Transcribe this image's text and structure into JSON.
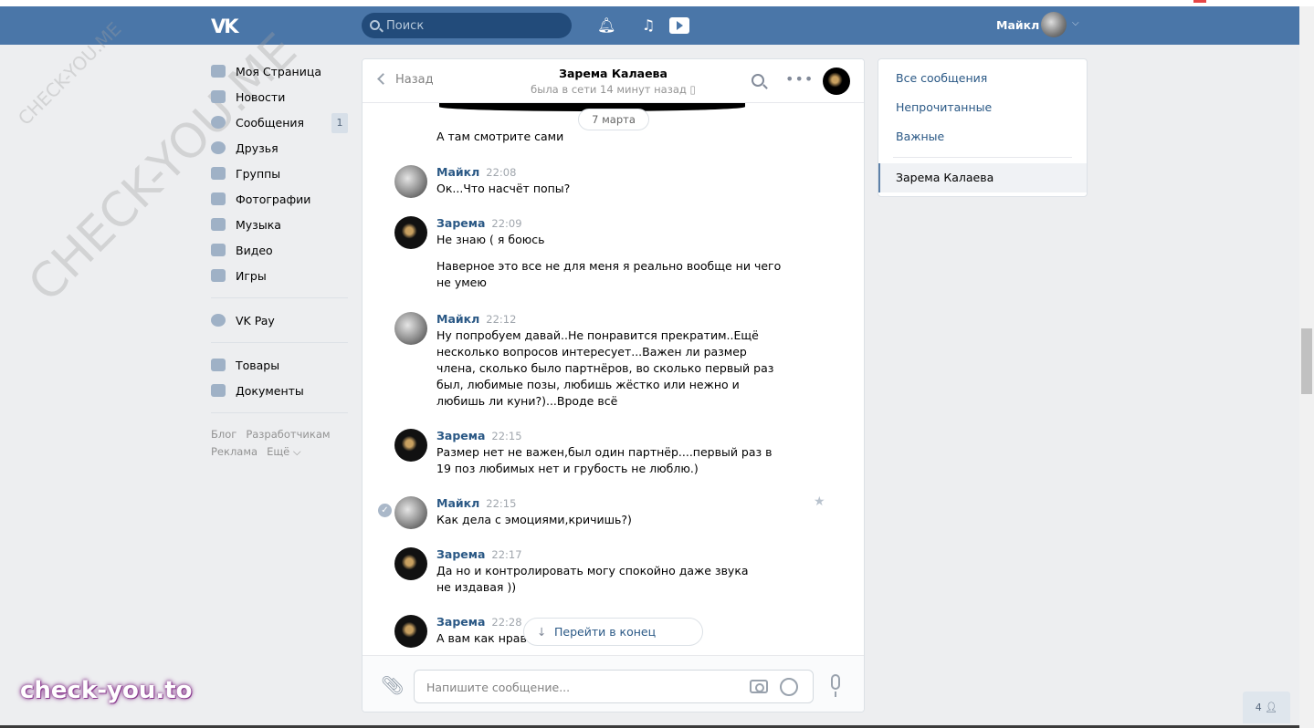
{
  "header": {
    "logo": "VK",
    "search_placeholder": "Поиск",
    "username": "Майкл"
  },
  "left_nav": {
    "items": [
      {
        "label": "Моя Страница",
        "icon": "home-icon"
      },
      {
        "label": "Новости",
        "icon": "news-icon"
      },
      {
        "label": "Сообщения",
        "icon": "messages-icon",
        "count": "1"
      },
      {
        "label": "Друзья",
        "icon": "friends-icon"
      },
      {
        "label": "Группы",
        "icon": "groups-icon"
      },
      {
        "label": "Фотографии",
        "icon": "camera-icon"
      },
      {
        "label": "Музыка",
        "icon": "music-icon"
      },
      {
        "label": "Видео",
        "icon": "video-icon"
      },
      {
        "label": "Игры",
        "icon": "games-icon"
      }
    ],
    "pay": {
      "label": "VK Pay",
      "icon": "vkpay-icon"
    },
    "extra": [
      {
        "label": "Товары",
        "icon": "bag-icon"
      },
      {
        "label": "Документы",
        "icon": "document-icon"
      }
    ],
    "footer": {
      "blog": "Блог",
      "devs": "Разработчикам",
      "ads": "Реклама",
      "more": "Ещё ⌵"
    }
  },
  "chat": {
    "back_label": "Назад",
    "peer_name": "Зарема Калаева",
    "peer_status": "была в сети 14 минут назад",
    "date_label": "7 марта",
    "jump_label": "Перейти в конец истории",
    "composer_placeholder": "Напишите сообщение...",
    "messages": [
      {
        "author": "",
        "time": "",
        "text": "А там смотрите сами"
      },
      {
        "author": "Майкл",
        "time": "22:08",
        "text": "Ок...Что насчёт попы?"
      },
      {
        "author": "Зарема",
        "time": "22:09",
        "text": "Не знаю ( я боюсь"
      },
      {
        "author": "",
        "time": "",
        "text": "Наверное это все не для меня я реально вообще ни чего не умею"
      },
      {
        "author": "Майкл",
        "time": "22:12",
        "text": "Ну попробуем давай..Не понравится прекратим..Ещё несколько вопросов интересует...Важен ли размер члена, сколько было партнёров, во сколько первый раз был, любимые позы, любишь жёстко или нежно и любишь ли куни?)...Вроде всё"
      },
      {
        "author": "Зарема",
        "time": "22:15",
        "text": "Размер нет не важен,был один партнёр....первый раз в 19 поз любимых нет и грубость не люблю.)"
      },
      {
        "author": "Майкл",
        "time": "22:15",
        "text": "Как дела с эмоциями,кричишь?)"
      },
      {
        "author": "Зарема",
        "time": "22:17",
        "text": "Да но и контролировать могу спокойно даже звука не издавая ))"
      },
      {
        "author": "Зарема",
        "time": "22:28",
        "text": "А вам как нрави"
      }
    ]
  },
  "right_menu": {
    "items": [
      "Все сообщения",
      "Непрочитанные",
      "Важные"
    ],
    "active": "Зарема Калаева"
  },
  "watermarks": {
    "diagonal_large": "CHECK-YOU.ME",
    "diagonal_small": "CHECK-YOU.ME",
    "bottom": "check-you.to"
  },
  "people_button": "4"
}
